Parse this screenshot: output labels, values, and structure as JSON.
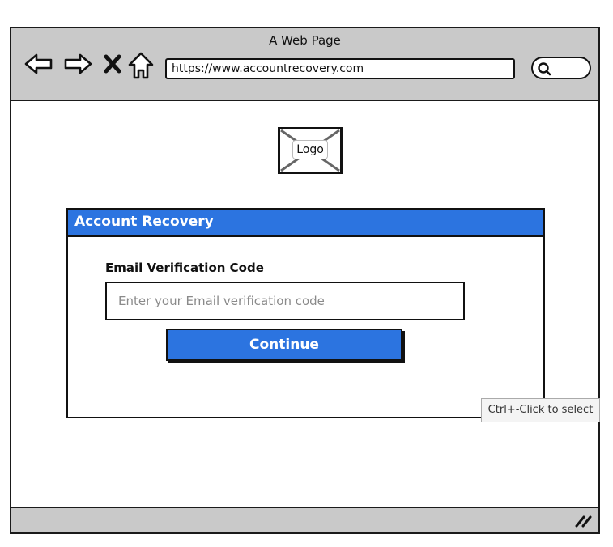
{
  "window": {
    "title": "A Web Page",
    "url": "https://www.accountrecovery.com"
  },
  "logo": {
    "label": "Logo"
  },
  "recovery": {
    "header": "Account Recovery",
    "field_label": "Email Verification Code",
    "field_placeholder": "Enter your Email verification code",
    "field_value": "",
    "continue_label": "Continue"
  },
  "tooltip": {
    "text": "Ctrl+-Click to select"
  },
  "icons": [
    "back-arrow-icon",
    "forward-arrow-icon",
    "close-icon",
    "home-icon",
    "search-icon",
    "resize-grip-icon"
  ],
  "colors": {
    "accent": "#2c74e0",
    "chrome": "#c9c9c9",
    "border": "#111111"
  }
}
